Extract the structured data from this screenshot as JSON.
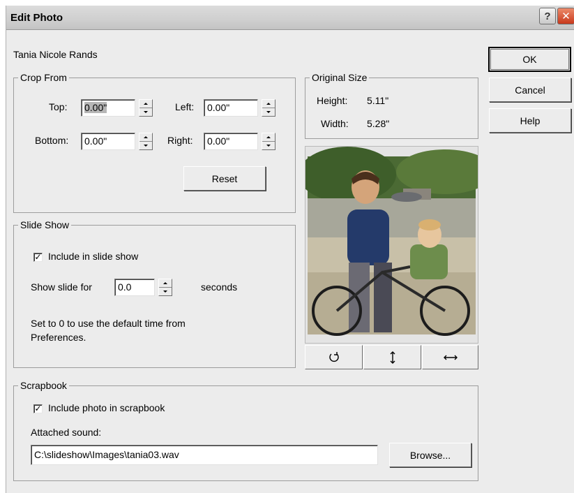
{
  "window": {
    "title": "Edit Photo",
    "help_glyph": "?",
    "close_glyph": "✕"
  },
  "person_name": "Tania Nicole Rands",
  "crop": {
    "legend": "Crop From",
    "top_label": "Top:",
    "top_value": "0.00\"",
    "left_label": "Left:",
    "left_value": "0.00\"",
    "bottom_label": "Bottom:",
    "bottom_value": "0.00\"",
    "right_label": "Right:",
    "right_value": "0.00\"",
    "reset_label": "Reset"
  },
  "original_size": {
    "legend": "Original Size",
    "height_label": "Height:",
    "height_value": "5.11\"",
    "width_label": "Width:",
    "width_value": "5.28\""
  },
  "slideshow": {
    "legend": "Slide Show",
    "include_label": "Include in slide show",
    "include_checked": true,
    "show_for_label": "Show slide for",
    "show_for_value": "0.0",
    "seconds_label": "seconds",
    "note": "Set to 0 to use the default time from Preferences."
  },
  "scrapbook": {
    "legend": "Scrapbook",
    "include_label": "Include photo in scrapbook",
    "include_checked": true,
    "sound_label": "Attached sound:",
    "sound_path": "C:\\slideshow\\Images\\tania03.wav",
    "browse_label": "Browse..."
  },
  "buttons": {
    "ok": "OK",
    "cancel": "Cancel",
    "help": "Help"
  },
  "tools": {
    "rotate_icon": "rotate-icon",
    "flip_vertical_icon": "flip-vertical-icon",
    "flip_horizontal_icon": "flip-horizontal-icon"
  },
  "colors": {
    "dialog_bg": "#ececec",
    "close_button": "#d9532f"
  }
}
